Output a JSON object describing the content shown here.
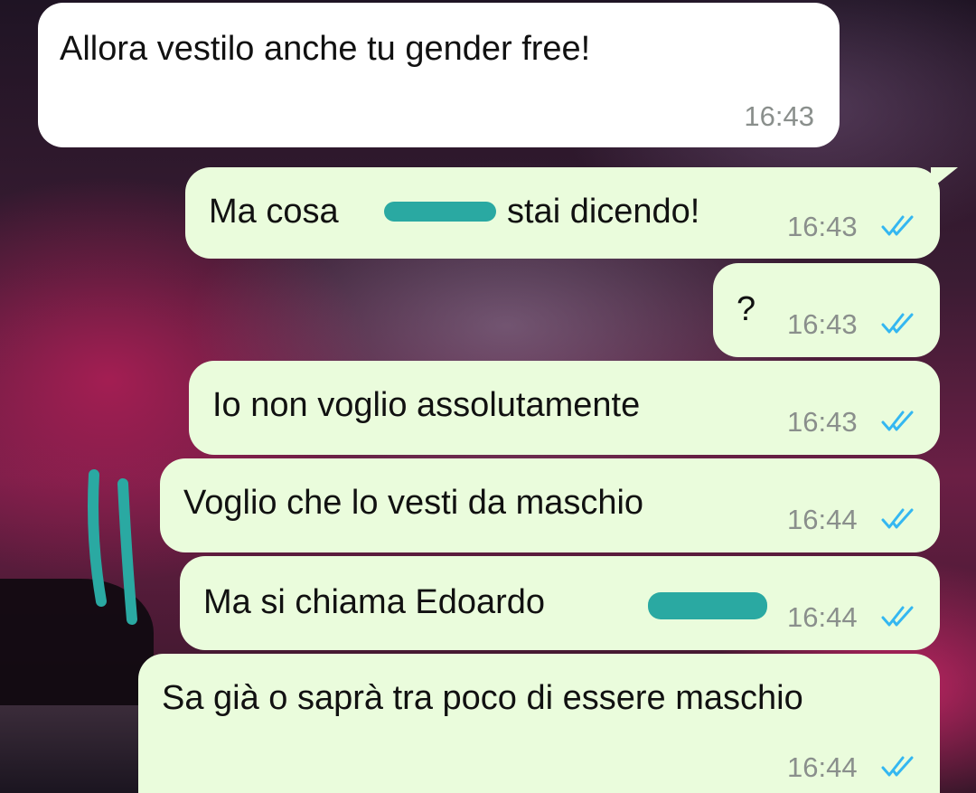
{
  "chat": {
    "messages": [
      {
        "direction": "incoming",
        "text": "Allora vestilo anche tu gender free!",
        "time": "16:43"
      },
      {
        "direction": "outgoing",
        "text_before": "Ma cosa",
        "text_after": "stai dicendo!",
        "time": "16:43",
        "status": "read",
        "redacted": true
      },
      {
        "direction": "outgoing",
        "text": "?",
        "time": "16:43",
        "status": "read"
      },
      {
        "direction": "outgoing",
        "text": "Io non voglio assolutamente",
        "time": "16:43",
        "status": "read"
      },
      {
        "direction": "outgoing",
        "text": "Voglio che lo vesti da maschio",
        "time": "16:44",
        "status": "read"
      },
      {
        "direction": "outgoing",
        "text_before": "Ma si chiama Edoardo",
        "time": "16:44",
        "status": "read",
        "redacted": true
      },
      {
        "direction": "outgoing",
        "text": "Sa già o saprà tra poco di essere maschio",
        "time": "16:44",
        "status": "read"
      }
    ]
  },
  "colors": {
    "incoming_bubble": "#ffffff",
    "outgoing_bubble": "#eafcdc",
    "read_check": "#34b7f1",
    "redaction": "#2aa9a2",
    "timestamp": "#8a8f8c"
  },
  "icons": {
    "read_receipt": "double-check-icon"
  }
}
